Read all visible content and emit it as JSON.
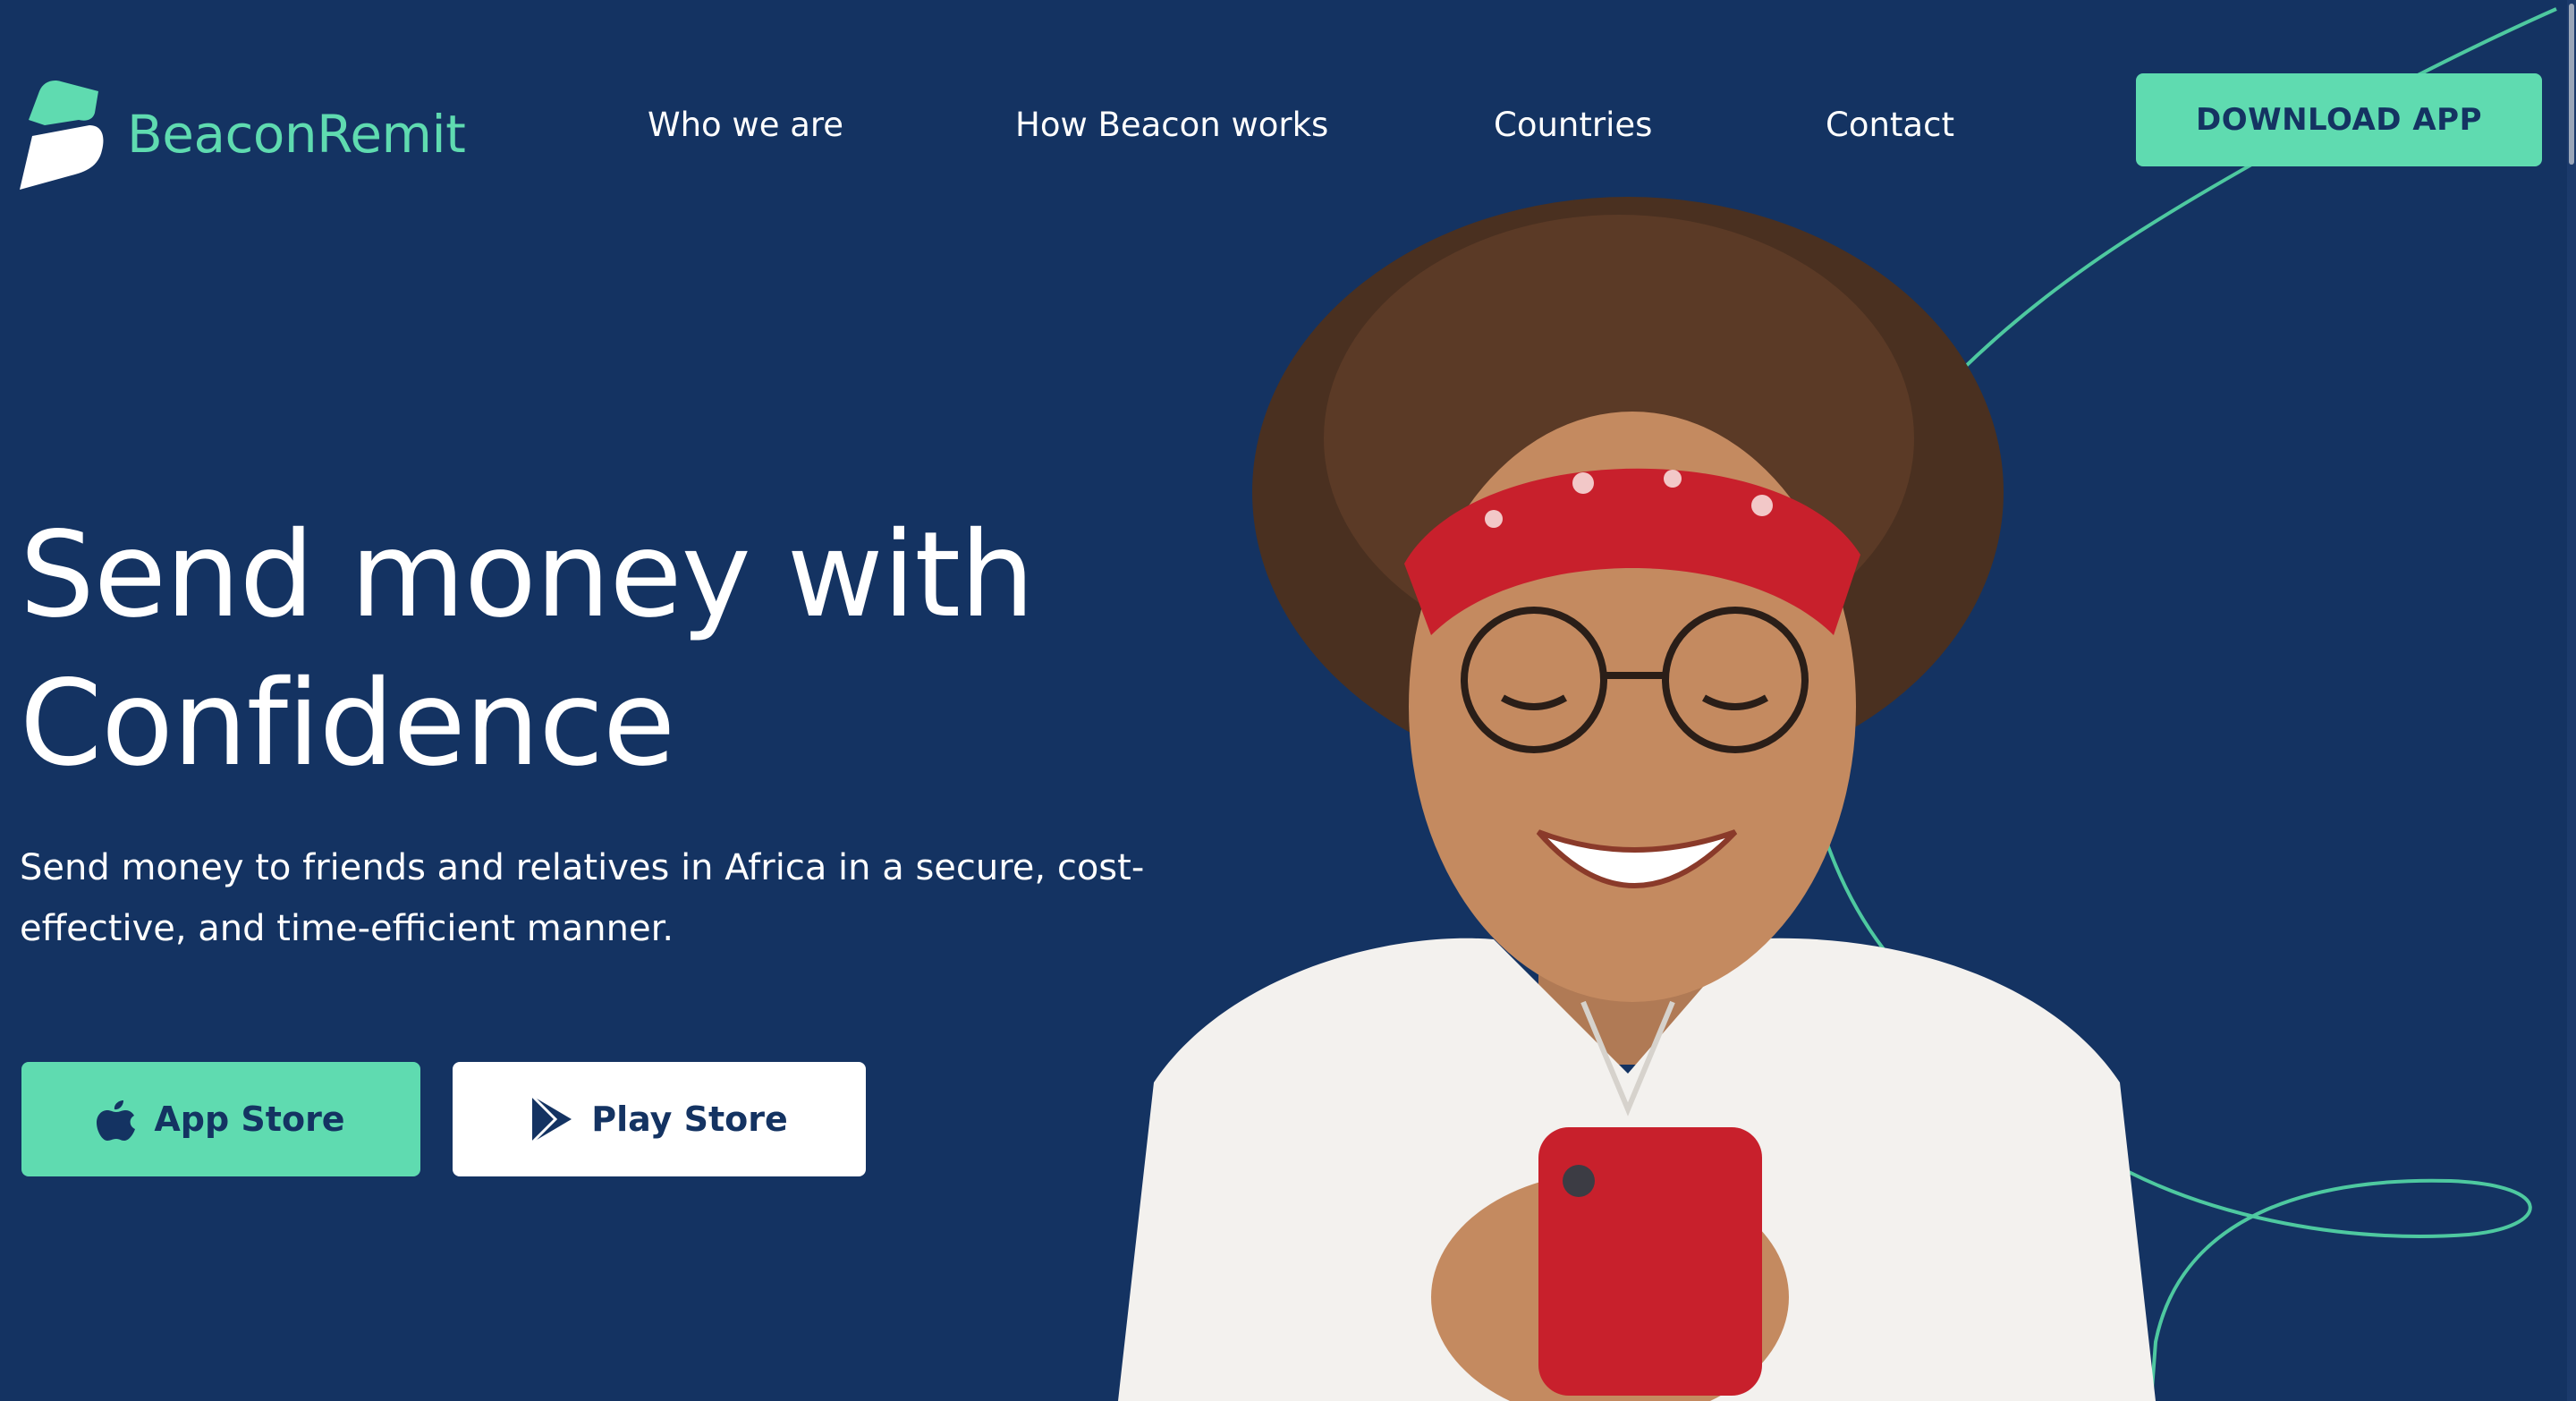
{
  "brand": {
    "name_part1": "Beacon",
    "name_part2": "Remit",
    "primary_color": "#143362",
    "accent_color": "#5fdbb0"
  },
  "nav": {
    "links": [
      {
        "label": "Who we are"
      },
      {
        "label": "How Beacon works"
      },
      {
        "label": "Countries"
      },
      {
        "label": "Contact"
      }
    ],
    "cta_label": "DOWNLOAD APP"
  },
  "hero": {
    "title_line1": "Send money with",
    "title_line2": "Confidence",
    "subtitle": "Send money to friends and relatives in Africa in a secure, cost-effective, and time-efficient manner.",
    "buttons": {
      "app_store": {
        "label": "App Store",
        "icon": "apple-icon"
      },
      "play_store": {
        "label": "Play Store",
        "icon": "play-store-icon"
      }
    },
    "image": "smiling-woman-with-red-phone"
  }
}
